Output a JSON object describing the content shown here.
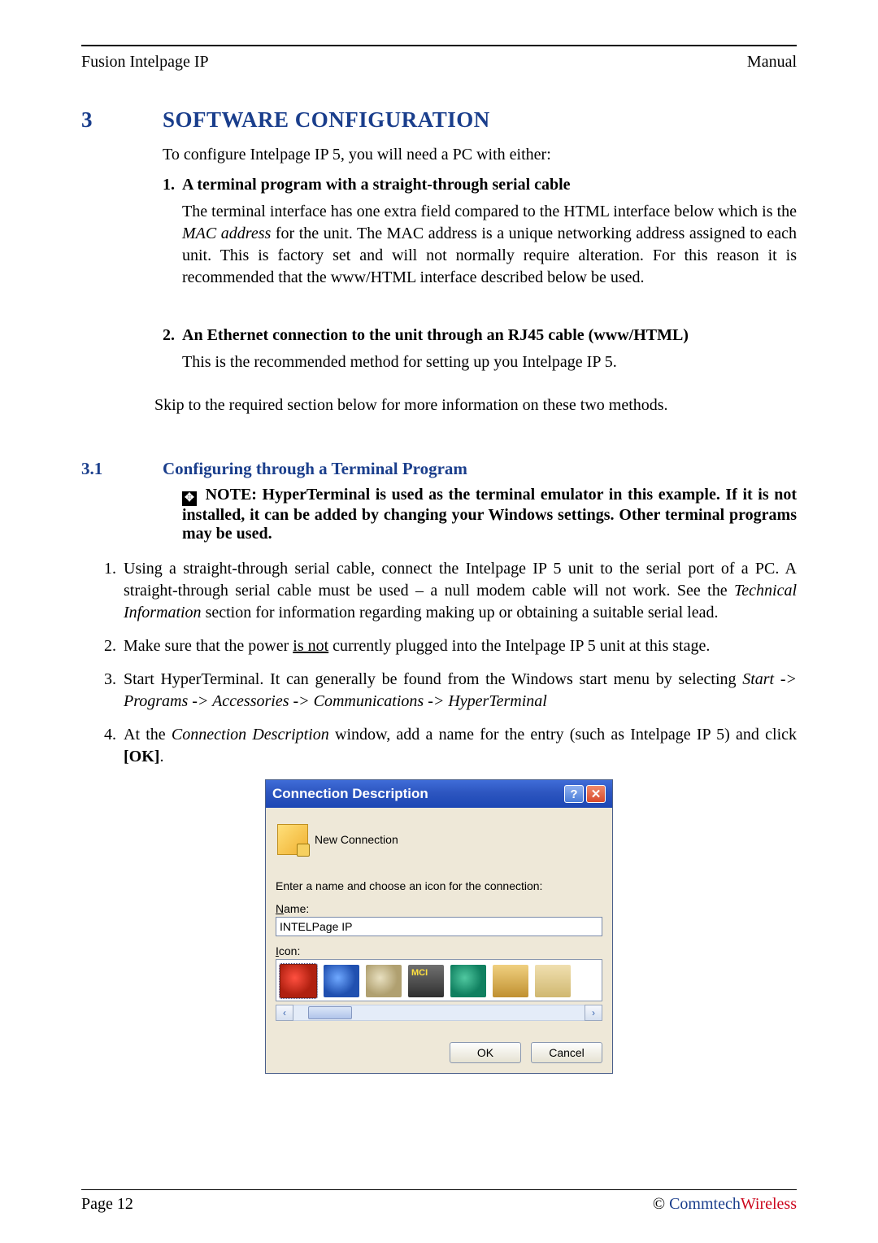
{
  "header": {
    "left": "Fusion Intelpage IP",
    "right": "Manual"
  },
  "section": {
    "number": "3",
    "title": "SOFTWARE CONFIGURATION"
  },
  "intro": "To configure Intelpage IP 5, you will need a PC with either:",
  "item1": {
    "num": "1.",
    "title": "A terminal program with a straight-through serial cable",
    "body_a": "The terminal interface has one extra field compared to the HTML interface below which is the ",
    "body_b": "MAC address",
    "body_c": " for the unit. The MAC address is a unique networking address assigned to each unit. This is factory set and will not normally require alteration. For this reason it is recommended that the www/HTML interface described below be used."
  },
  "item2": {
    "num": "2.",
    "title": "An Ethernet connection to the unit through an RJ45 cable (www/HTML)",
    "body": "This is the recommended method for setting up you Intelpage IP 5."
  },
  "skip": "Skip to the required section below for more information on these two methods.",
  "subsection": {
    "number": "3.1",
    "title": "Configuring through a Terminal Program"
  },
  "note": {
    "symbol": "✥",
    "text": " NOTE: HyperTerminal is used as the terminal emulator in this example. If it is not installed, it can be added by changing your Windows settings. Other terminal programs may be used."
  },
  "steps": {
    "s1a": "Using a straight-through serial cable, connect the Intelpage IP 5 unit to the serial port of a PC. A straight-through serial cable must be used – a null modem cable will not work. See the ",
    "s1b": "Technical Information",
    "s1c": " section for information regarding making up or obtaining a suitable serial lead.",
    "s2a": "Make sure that the power ",
    "s2b": "is not",
    "s2c": " currently plugged into the Intelpage IP 5 unit at this stage.",
    "s3a": "Start HyperTerminal. It can generally be found from the Windows start menu by selecting ",
    "s3b": "Start -> Programs -> Accessories -> Communications -> HyperTerminal",
    "s4a": "At the ",
    "s4b": "Connection Description",
    "s4c": " window, add a name for the entry (such as Intelpage IP 5) and click ",
    "s4d": "[OK]",
    "s4e": "."
  },
  "dialog": {
    "title": "Connection Description",
    "help": "?",
    "close": "✕",
    "newconn": "New Connection",
    "prompt": "Enter a name and choose an icon for the connection:",
    "name_label_u": "N",
    "name_label_rest": "ame:",
    "name_value": "INTELPage IP",
    "icon_label_u": "I",
    "icon_label_rest": "con:",
    "scroll_left": "‹",
    "scroll_right": "›",
    "ok": "OK",
    "cancel": "Cancel"
  },
  "footer": {
    "page": "Page 12",
    "copyright": "© ",
    "brand_a": "Commtech",
    "brand_b": "Wireless"
  }
}
